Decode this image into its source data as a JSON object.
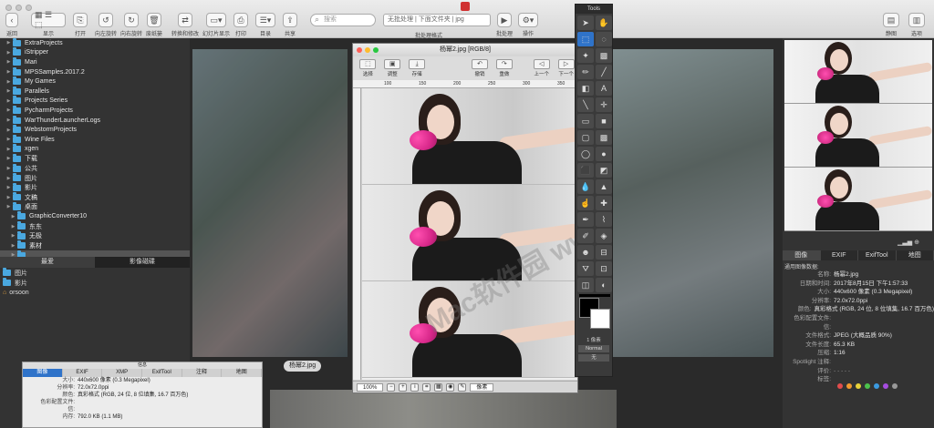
{
  "toolbar": {
    "buttons": [
      {
        "label": "返回",
        "icon": "chevron-left-icon"
      },
      {
        "label": "显示",
        "icon": "view-icon"
      },
      {
        "label": "打开",
        "icon": "open-icon"
      },
      {
        "label": "向左旋转",
        "icon": "rotate-left-icon"
      },
      {
        "label": "向右旋转",
        "icon": "rotate-right-icon"
      },
      {
        "label": "废纸篓",
        "icon": "trash-icon"
      },
      {
        "label": "转换和修改",
        "icon": "convert-icon"
      },
      {
        "label": "幻灯片显示",
        "icon": "slideshow-icon"
      },
      {
        "label": "打印",
        "icon": "print-icon"
      },
      {
        "label": "目录",
        "icon": "list-icon"
      },
      {
        "label": "共享",
        "icon": "share-icon"
      },
      {
        "label": "批处理",
        "icon": "batch-icon"
      },
      {
        "label": "操作",
        "icon": "gear-icon"
      },
      {
        "label": "静图",
        "icon": "still-icon"
      },
      {
        "label": "选项",
        "icon": "options-icon"
      }
    ],
    "search_placeholder": "搜索",
    "batch_combo": "无批处理 | 下面文件夹 | jpg",
    "batch_label": "批处理格式"
  },
  "sidebar": {
    "items": [
      {
        "label": "ExtraProjects",
        "indent": 1
      },
      {
        "label": "iStripper",
        "indent": 1
      },
      {
        "label": "Mari",
        "indent": 1
      },
      {
        "label": "MPSSamples.2017.2",
        "indent": 1
      },
      {
        "label": "My Games",
        "indent": 1
      },
      {
        "label": "Parallels",
        "indent": 1
      },
      {
        "label": "Projects Series",
        "indent": 1
      },
      {
        "label": "PycharmProjects",
        "indent": 1
      },
      {
        "label": "WarThunderLauncherLogs",
        "indent": 1
      },
      {
        "label": "WebstormProjects",
        "indent": 1
      },
      {
        "label": "Wine Files",
        "indent": 1
      },
      {
        "label": "xgen",
        "indent": 1
      },
      {
        "label": "下载",
        "indent": 1
      },
      {
        "label": "公共",
        "indent": 1
      },
      {
        "label": "图片",
        "indent": 1
      },
      {
        "label": "影片",
        "indent": 1
      },
      {
        "label": "文稿",
        "indent": 1
      },
      {
        "label": "桌面",
        "indent": 1
      },
      {
        "label": "GraphicConverter10",
        "indent": 2
      },
      {
        "label": "东东",
        "indent": 2
      },
      {
        "label": "无极",
        "indent": 2
      },
      {
        "label": "素材",
        "indent": 2
      },
      {
        "label": "",
        "indent": 2
      }
    ],
    "tabs": [
      {
        "label": "最爱",
        "active": true
      },
      {
        "label": "影像磁碟",
        "active": false
      }
    ],
    "favorites": [
      {
        "label": "图片",
        "icon": "folder-icon"
      },
      {
        "label": "影片",
        "icon": "folder-icon"
      },
      {
        "label": "orsoon",
        "icon": "home-icon"
      }
    ]
  },
  "browser": {
    "file_label": "杨幂2.jpg"
  },
  "image_window": {
    "title": "杨幂2.jpg [RGB/8]",
    "tools": [
      "选择",
      "调整",
      "存储",
      "撤销",
      "重做",
      "上一个",
      "下一个"
    ],
    "ruler_marks": [
      "100",
      "150",
      "200",
      "250",
      "300",
      "350"
    ],
    "zoom": "100%",
    "status_select": "像素",
    "watermark": "Mac软件园 www.mac201314.com"
  },
  "tools_palette": {
    "title": "Tools",
    "footer_size": "1 像素",
    "mode": "Normal",
    "extra": "无"
  },
  "right_panel": {
    "tabs": [
      {
        "label": "图像",
        "active": true
      },
      {
        "label": "EXIF",
        "active": false
      },
      {
        "label": "ExifTool",
        "active": false
      },
      {
        "label": "地图",
        "active": false
      }
    ],
    "header": "通用图像数据:",
    "info": [
      {
        "k": "名称:",
        "v": "杨幂2.jpg"
      },
      {
        "k": "日期和时间:",
        "v": "2017年8月15日 下午1:57:33"
      },
      {
        "k": "大小:",
        "v": "440x600 像素 (0.3 Megapixel)"
      },
      {
        "k": "分辨率:",
        "v": "72.0x72.0ppi"
      },
      {
        "k": "颜色:",
        "v": "真彩格式 (RGB, 24 位, 8 位填集, 16.7 百万色)"
      },
      {
        "k": "色彩配置文件:",
        "v": ""
      },
      {
        "k": "信:",
        "v": ""
      },
      {
        "k": "文件格式:",
        "v": "JPEG (大概品质 90%)"
      },
      {
        "k": "文件长度:",
        "v": "65.3 KB"
      },
      {
        "k": "压缩:",
        "v": "1:16"
      },
      {
        "k": "Spotlight 注释:",
        "v": ""
      },
      {
        "k": "评价:",
        "v": "· · · · ·"
      },
      {
        "k": "标签:",
        "v": ""
      }
    ],
    "label_colors": [
      "#e24c4c",
      "#f29a2e",
      "#e8d23a",
      "#4cc24c",
      "#3b9ae0",
      "#a64de0",
      "#999999"
    ]
  },
  "info_panel": {
    "title": "信息",
    "tabs": [
      {
        "label": "图像",
        "active": true
      },
      {
        "label": "EXIF",
        "active": false
      },
      {
        "label": "XMP",
        "active": false
      },
      {
        "label": "ExifTool",
        "active": false
      },
      {
        "label": "注释",
        "active": false
      },
      {
        "label": "地图",
        "active": false
      }
    ],
    "rows": [
      {
        "k": "大小:",
        "v": "440x600 像素 (0.3 Megapixel)"
      },
      {
        "k": "分辨率:",
        "v": "72.0x72.0ppi"
      },
      {
        "k": "颜色:",
        "v": "真彩格式 (RGB, 24 位, 8 位填集, 16.7 百万色)"
      },
      {
        "k": "色彩配置文件:",
        "v": ""
      },
      {
        "k": "信:",
        "v": ""
      },
      {
        "k": "内存:",
        "v": "792.0 KB (1.1 MB)"
      }
    ]
  }
}
